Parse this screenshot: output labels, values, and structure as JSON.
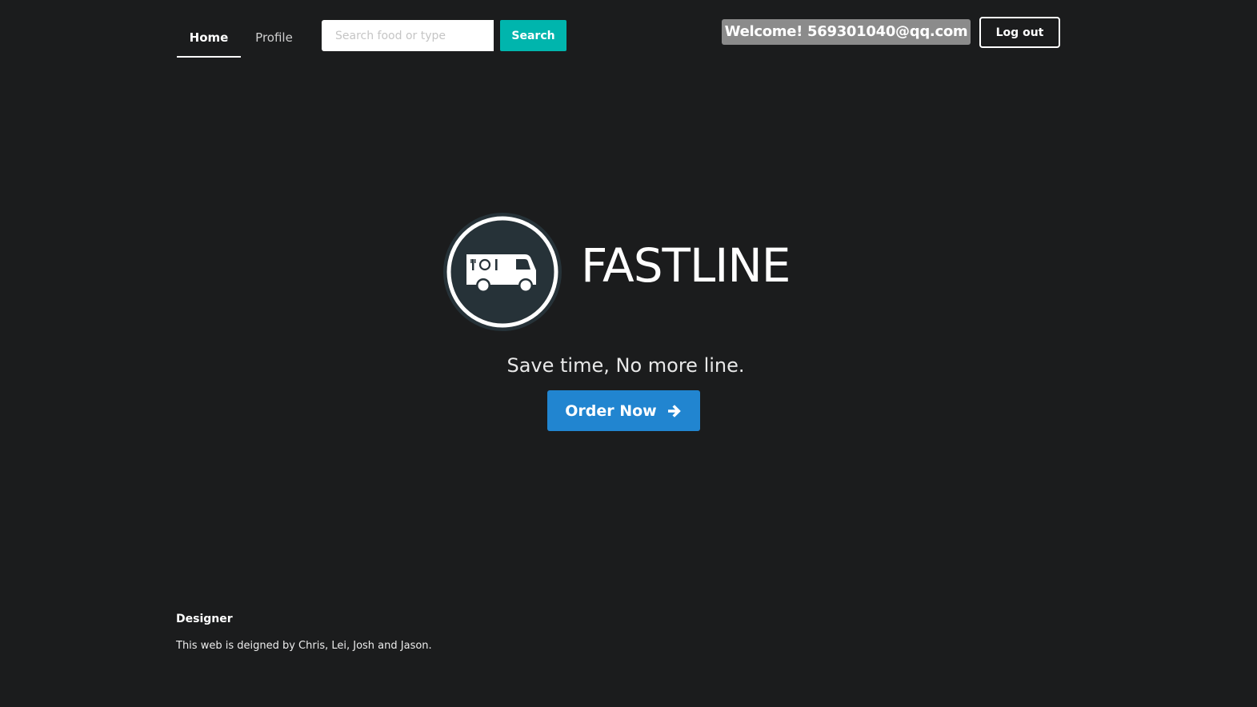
{
  "nav": {
    "items": [
      {
        "label": "Home",
        "active": true
      },
      {
        "label": "Profile",
        "active": false
      }
    ]
  },
  "search": {
    "placeholder": "Search food or type",
    "value": "",
    "button_label": "Search"
  },
  "user": {
    "welcome": "Welcome! 569301040@qq.com",
    "logout_label": "Log out"
  },
  "hero": {
    "logo_icon": "food-truck-icon",
    "title": "FASTLINE",
    "tagline": "Save time, No more line.",
    "cta_label": "Order Now",
    "cta_icon": "arrow-right-icon"
  },
  "footer": {
    "heading": "Designer",
    "text": "This web is deigned by Chris, Lei, Josh and Jason."
  },
  "colors": {
    "background": "#1b1c1d",
    "search_button": "#00b5ad",
    "order_button": "#2185d0",
    "welcome_badge": "#8b8b8b",
    "logo_circle": "#263238"
  }
}
